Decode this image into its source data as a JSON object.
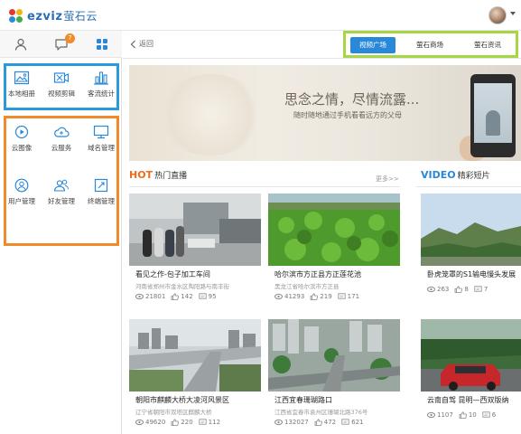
{
  "app": {
    "logo_text": "ezviz",
    "logo_cn": "萤石云"
  },
  "colors": {
    "accent_blue": "#2a88d8",
    "hot_orange": "#ef6c1c",
    "local_box": "#2b9ad8",
    "cloud_box": "#f08a2a",
    "nav_box": "#a7d645"
  },
  "sidebar": {
    "tabs": [
      {
        "icon": "user-icon"
      },
      {
        "icon": "message-icon",
        "badge": "7"
      },
      {
        "icon": "apps-grid-icon"
      }
    ],
    "local_items": [
      {
        "label": "本地相册",
        "icon": "photo-album-icon"
      },
      {
        "label": "视频剪辑",
        "icon": "video-edit-icon"
      },
      {
        "label": "客流统计",
        "icon": "bar-chart-icon"
      }
    ],
    "cloud_items": [
      {
        "label": "云图像",
        "icon": "cloud-video-icon"
      },
      {
        "label": "云服务",
        "icon": "cloud-service-icon"
      },
      {
        "label": "域名管理",
        "icon": "monitor-icon"
      },
      {
        "label": "用户管理",
        "icon": "user-manage-icon"
      },
      {
        "label": "好友管理",
        "icon": "friends-icon"
      },
      {
        "label": "终端管理",
        "icon": "terminal-icon"
      }
    ]
  },
  "subbar": {
    "back_label": "返回",
    "nav_tabs": [
      {
        "label": "视频广场",
        "active": true
      },
      {
        "label": "萤石商场",
        "active": false
      },
      {
        "label": "萤石资讯",
        "active": false
      }
    ]
  },
  "banner": {
    "title": "思念之情，尽情流露...",
    "subtitle": "随时随地通过手机看看远方的父母"
  },
  "hot": {
    "en": "HOT",
    "cn": "热门直播",
    "more": "更多>>"
  },
  "video": {
    "en": "VIDEO",
    "cn": "精彩短片"
  },
  "cards": [
    {
      "title": "看见之作-包子加工车间",
      "addr": "河南省郑州市金水区陶阳路与南丰街",
      "views": "21801",
      "likes": "142",
      "comments": "95"
    },
    {
      "title": "哈尔滨市方正县方正莲花池",
      "addr": "黑龙江省哈尔滨市方正县",
      "views": "41293",
      "likes": "219",
      "comments": "171"
    },
    {
      "title": "卧虎笼罩的S1输电慢头发展",
      "addr": "",
      "views": "263",
      "likes": "8",
      "comments": "7"
    },
    {
      "title": "朝阳市麒麟大桥大凌河风景区",
      "addr": "辽宁省朝阳市双塔区麒麟大桥",
      "views": "49620",
      "likes": "220",
      "comments": "112"
    },
    {
      "title": "江西宜春珊瑚路口",
      "addr": "江西省宜春市袁州区珊瑚北路376号",
      "views": "132027",
      "likes": "472",
      "comments": "621"
    },
    {
      "title": "云南自驾 昆明—西双版纳",
      "addr": "",
      "views": "1107",
      "likes": "10",
      "comments": "6"
    }
  ]
}
